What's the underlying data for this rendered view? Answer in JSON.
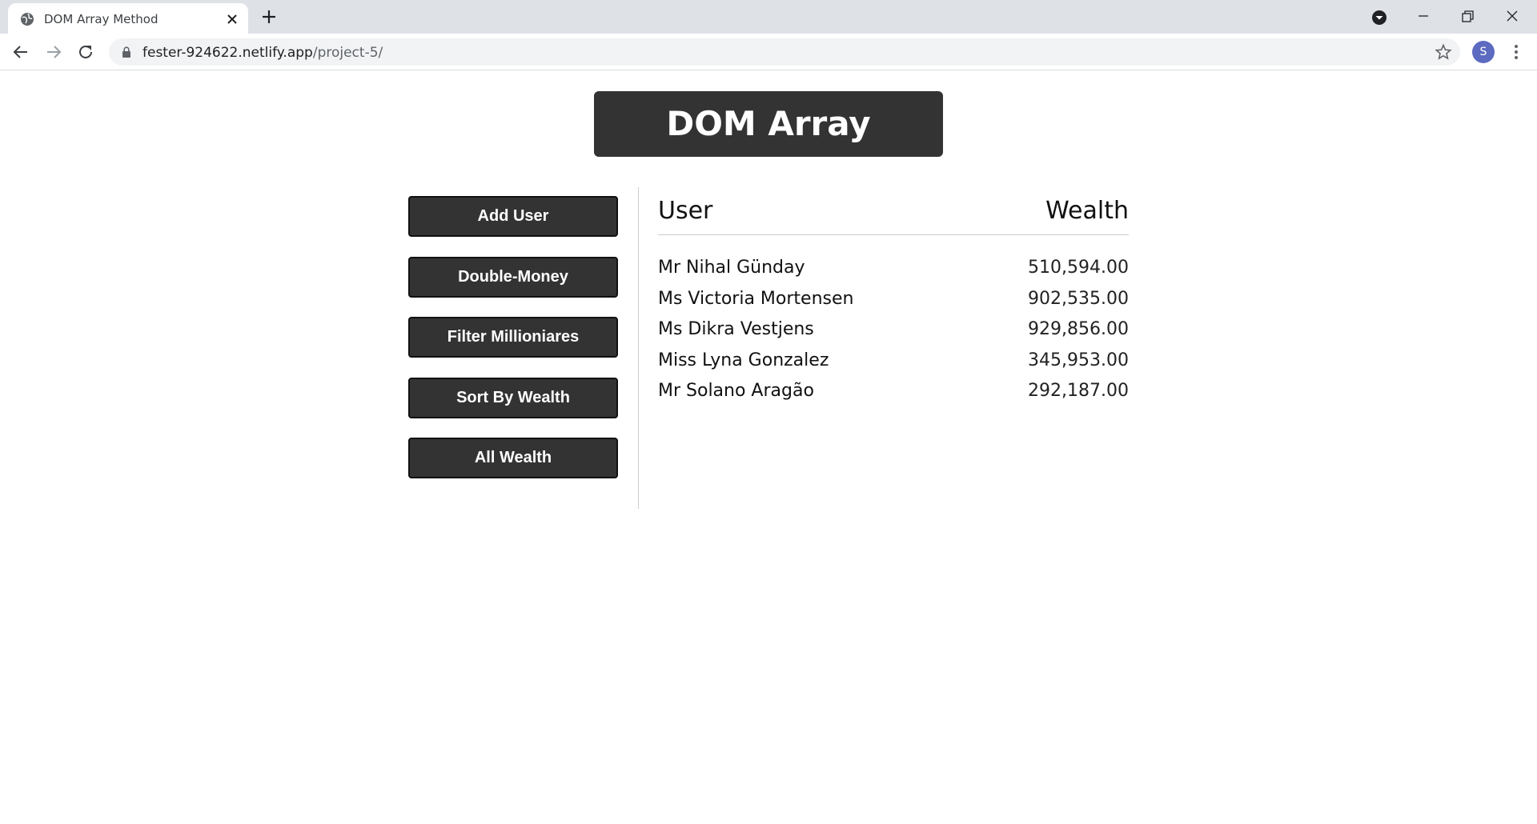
{
  "browser": {
    "tab_title": "DOM Array Method",
    "url_host": "fester-924622.netlify.app",
    "url_path": "/project-5/",
    "profile_initial": "S"
  },
  "page": {
    "title": "DOM Array Method",
    "buttons": {
      "add_user": "Add User",
      "double_money": "Double-Money",
      "filter": "Filter Millioniares",
      "sort": "Sort By Wealth",
      "all_wealth": "All Wealth"
    },
    "table": {
      "header_user": "User",
      "header_wealth": "Wealth",
      "rows": [
        {
          "name": "Mr Nihal Günday",
          "wealth": "510,594.00"
        },
        {
          "name": "Ms Victoria Mortensen",
          "wealth": "902,535.00"
        },
        {
          "name": "Ms Dikra Vestjens",
          "wealth": "929,856.00"
        },
        {
          "name": "Miss Lyna Gonzalez",
          "wealth": "345,953.00"
        },
        {
          "name": "Mr Solano Aragão",
          "wealth": "292,187.00"
        }
      ]
    }
  },
  "colors": {
    "button_bg": "#333333",
    "chrome_tabbar": "#dee1e6",
    "avatar": "#5c6bc0"
  }
}
